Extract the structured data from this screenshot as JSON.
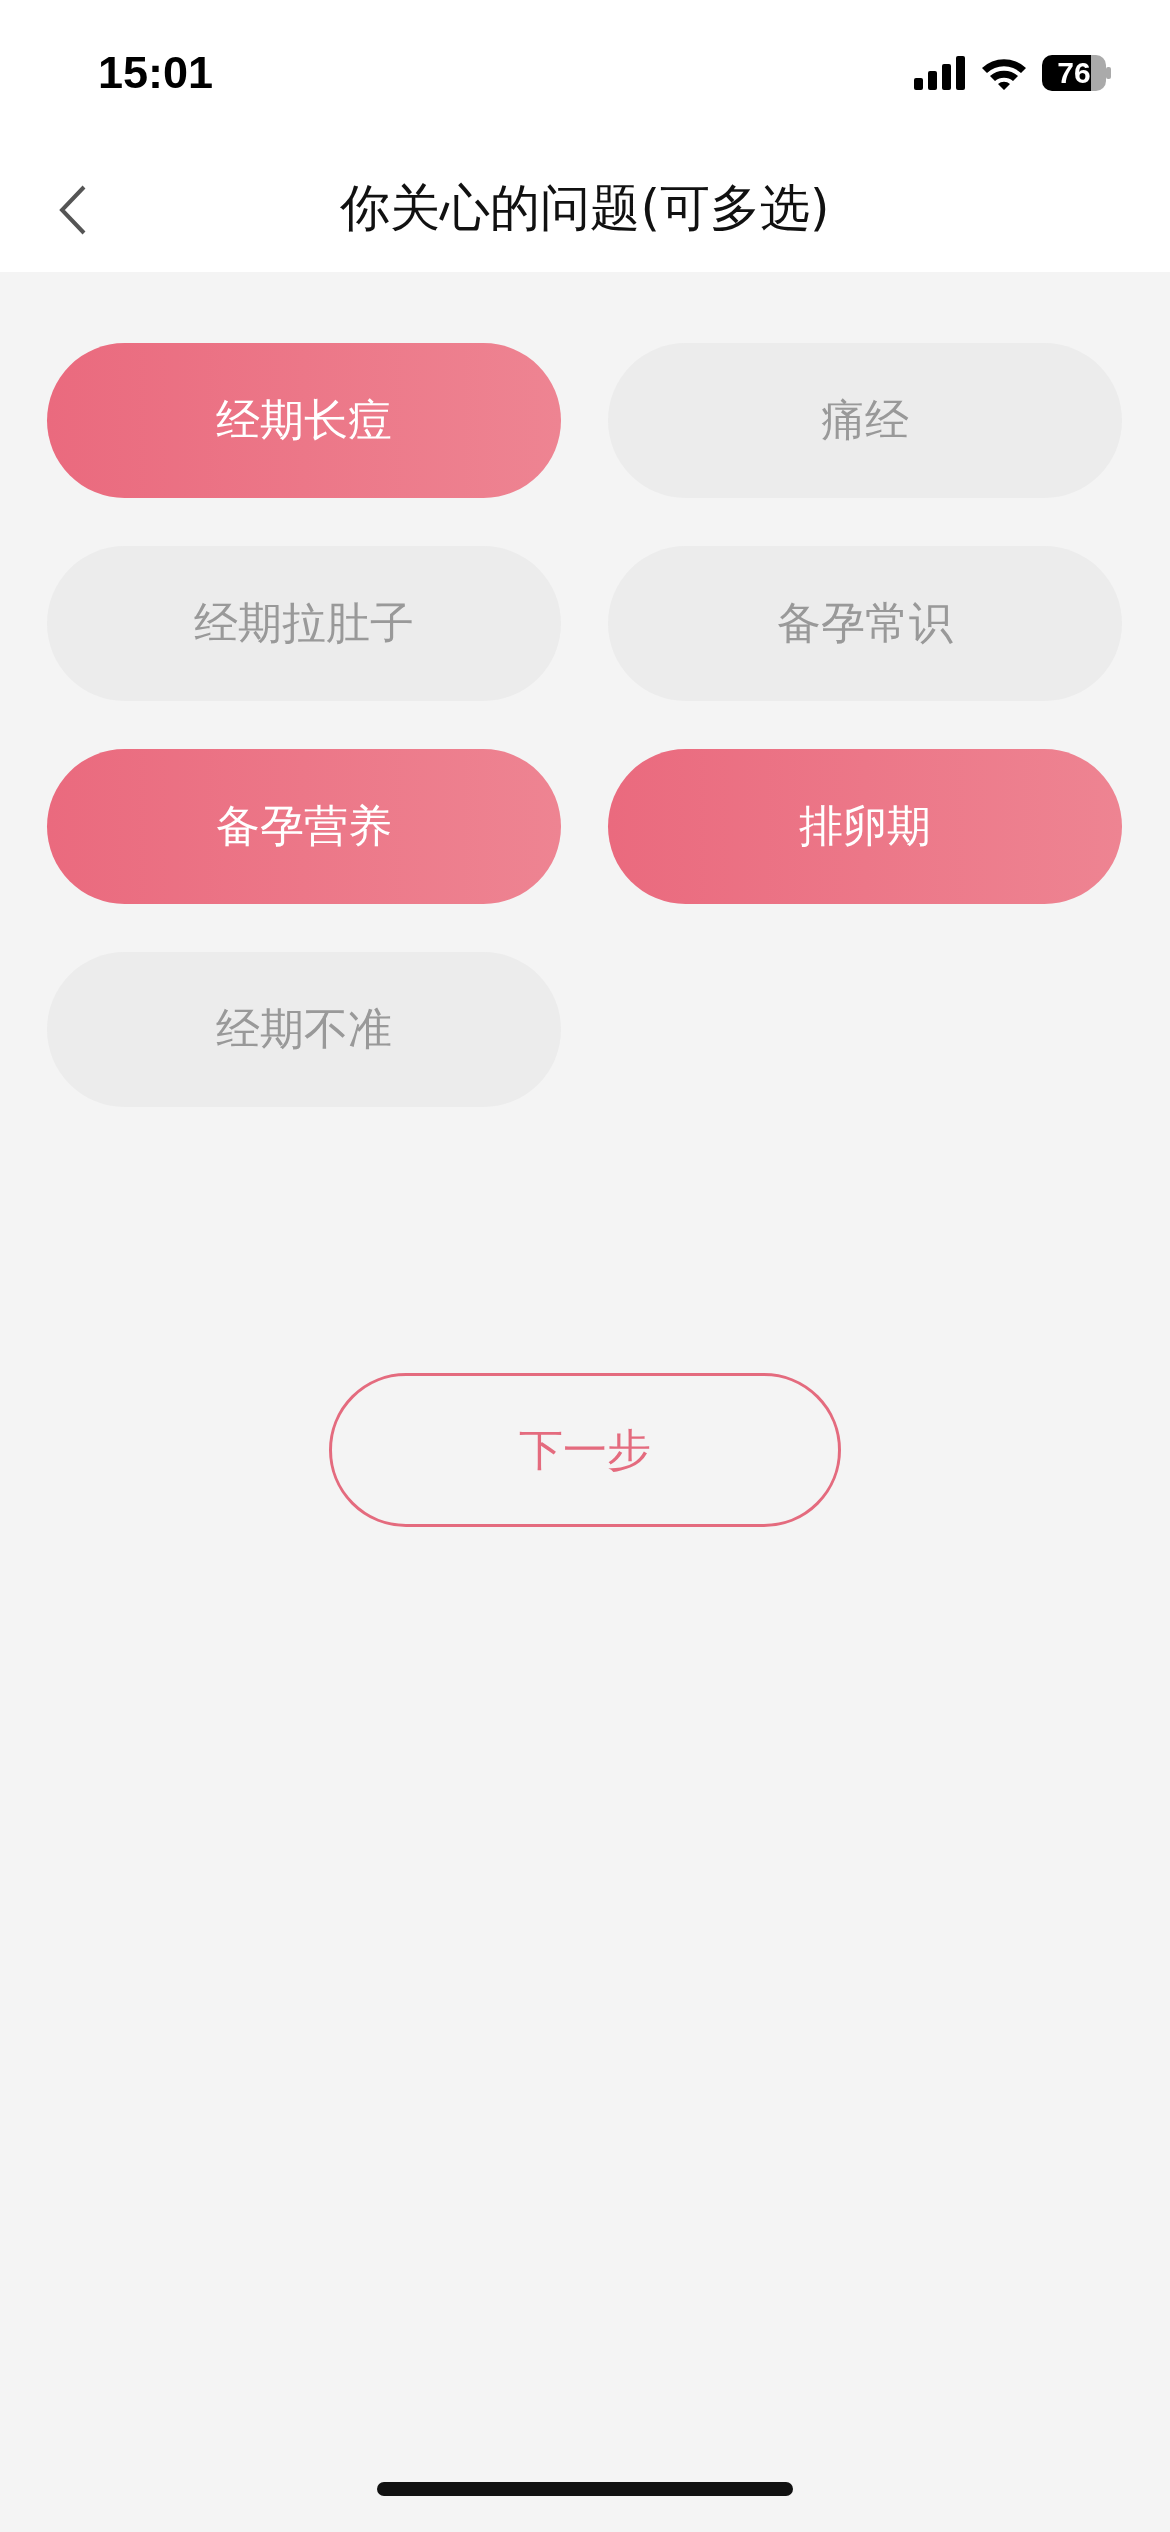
{
  "status_bar": {
    "time": "15:01",
    "battery": "76"
  },
  "nav": {
    "title": "你关心的问题(可多选)"
  },
  "options": [
    {
      "label": "经期长痘",
      "selected": true
    },
    {
      "label": "痛经",
      "selected": false
    },
    {
      "label": "经期拉肚子",
      "selected": false
    },
    {
      "label": "备孕常识",
      "selected": false
    },
    {
      "label": "备孕营养",
      "selected": true
    },
    {
      "label": "排卵期",
      "selected": true
    },
    {
      "label": "经期不准",
      "selected": false
    }
  ],
  "next_button": {
    "label": "下一步"
  }
}
